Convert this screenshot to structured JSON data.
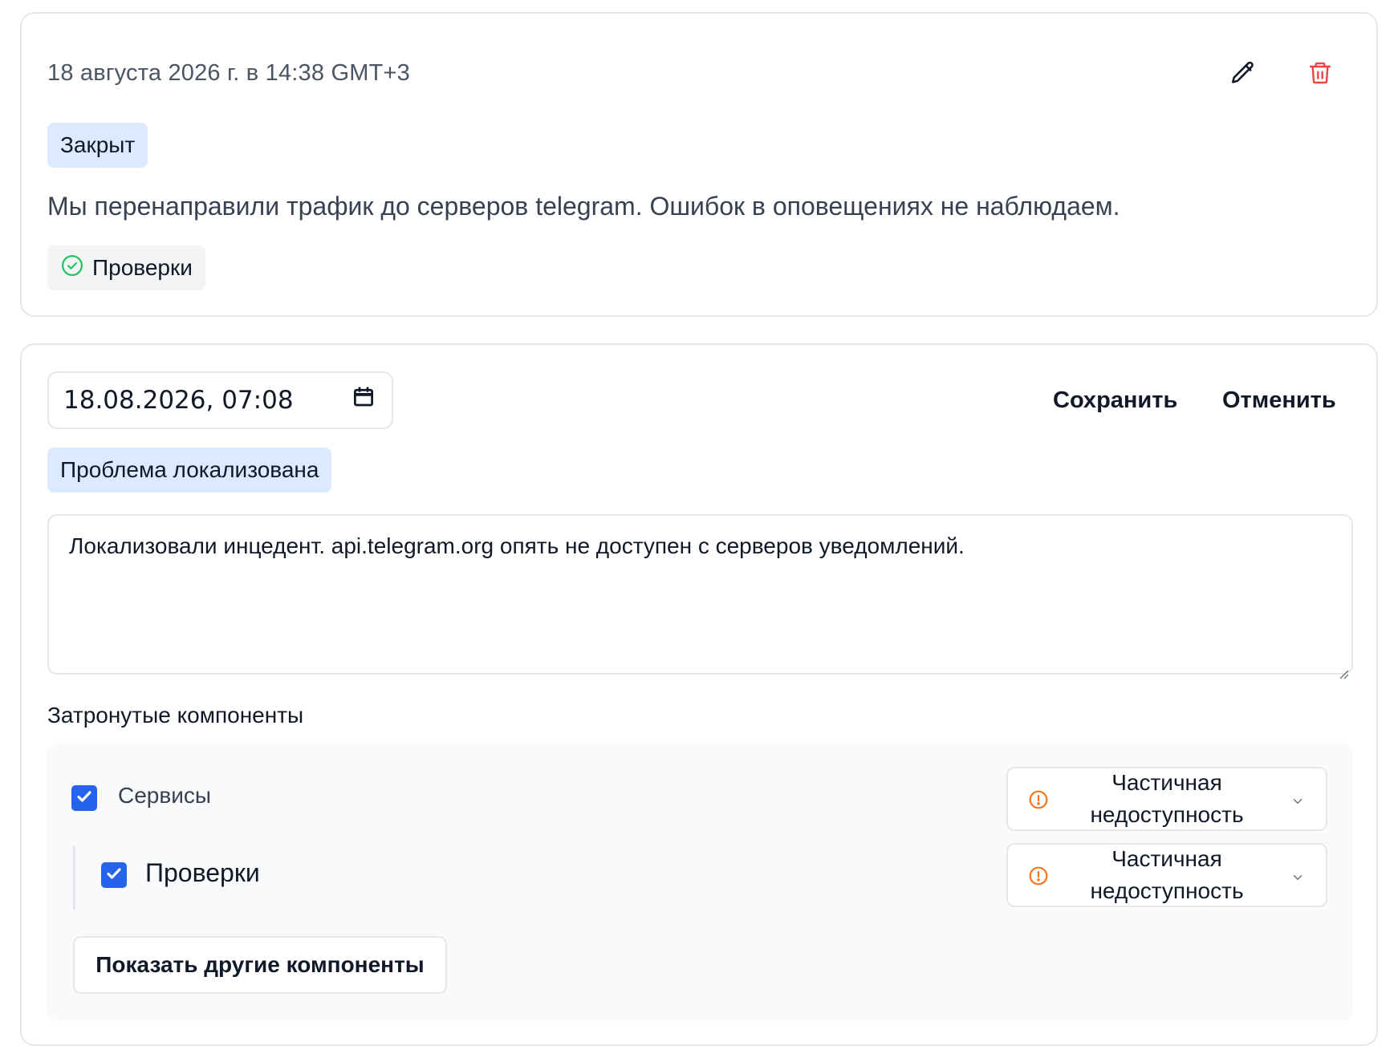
{
  "update_card": {
    "timestamp": "18 августа 2026 г. в 14:38 GMT+3",
    "status_badge": "Закрыт",
    "message": "Мы перенаправили трафик до серверов telegram. Ошибок в оповещениях не наблюдаем.",
    "component_chip": "Проверки",
    "edit_icon": "pencil-icon",
    "delete_icon": "trash-icon",
    "delete_color": "#ef4444",
    "chip_icon_color": "#22c55e"
  },
  "edit_card": {
    "datetime_value": "18.08.2026, 07:08",
    "save_label": "Сохранить",
    "cancel_label": "Отменить",
    "status_badge": "Проблема локализована",
    "message_value": "Локализовали инцедент. api.telegram.org опять не доступен с серверов уведомлений.",
    "affected_label": "Затронутые компоненты",
    "components": [
      {
        "name": "Сервисы",
        "checked": true,
        "status_line1": "Частичная",
        "status_line2": "недоступность"
      },
      {
        "name": "Проверки",
        "checked": true,
        "status_line1": "Частичная",
        "status_line2": "недоступность"
      }
    ],
    "show_more_label": "Показать другие компоненты",
    "accent_color": "#2563eb",
    "warning_color": "#f97316"
  }
}
